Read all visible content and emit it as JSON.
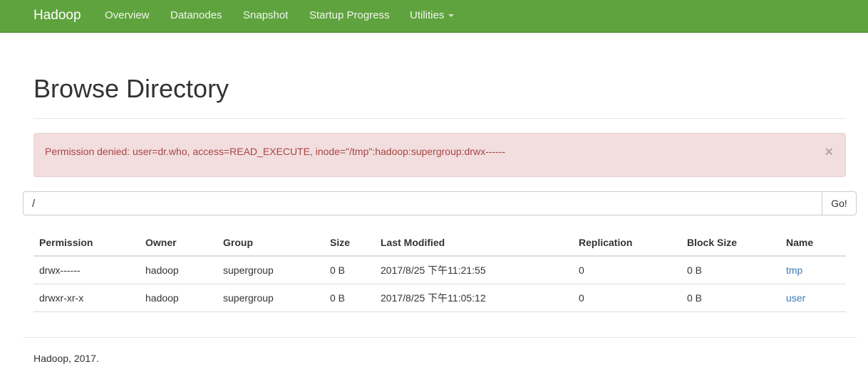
{
  "navbar": {
    "brand": "Hadoop",
    "items": [
      {
        "label": "Overview"
      },
      {
        "label": "Datanodes"
      },
      {
        "label": "Snapshot"
      },
      {
        "label": "Startup Progress"
      },
      {
        "label": "Utilities"
      }
    ]
  },
  "page": {
    "title": "Browse Directory"
  },
  "alert": {
    "message": "Permission denied: user=dr.who, access=READ_EXECUTE, inode=\"/tmp\":hadoop:supergroup:drwx------",
    "close_symbol": "×"
  },
  "path_bar": {
    "value": "/",
    "go_label": "Go!"
  },
  "table": {
    "headers": [
      "Permission",
      "Owner",
      "Group",
      "Size",
      "Last Modified",
      "Replication",
      "Block Size",
      "Name"
    ],
    "rows": [
      [
        "drwx------",
        "hadoop",
        "supergroup",
        "0 B",
        "2017/8/25 下午11:21:55",
        "0",
        "0 B",
        "tmp"
      ],
      [
        "drwxr-xr-x",
        "hadoop",
        "supergroup",
        "0 B",
        "2017/8/25 下午11:05:12",
        "0",
        "0 B",
        "user"
      ]
    ]
  },
  "footer": {
    "text": "Hadoop, 2017."
  },
  "colors": {
    "navbar": "#5fa33e",
    "alert_bg": "#f2dede",
    "alert_text": "#a94442",
    "link": "#337ab7"
  }
}
